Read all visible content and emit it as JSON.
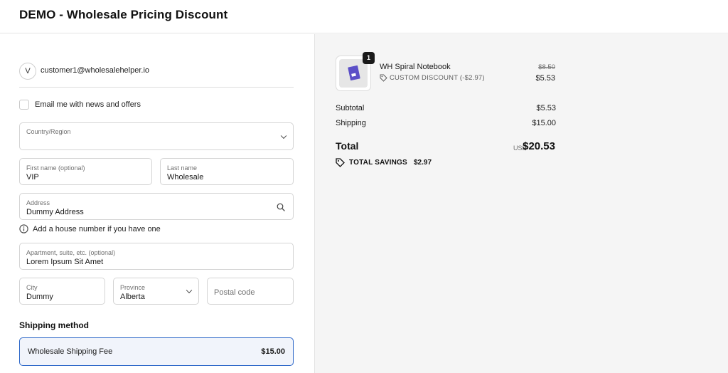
{
  "header": {
    "store_title": "DEMO - Wholesale Pricing Discount"
  },
  "account": {
    "avatar_initial": "V",
    "email": "customer1@wholesalehelper.io"
  },
  "marketing": {
    "checkbox_label": "Email me with news and offers",
    "checked": false
  },
  "form": {
    "country": {
      "label": "Country/Region",
      "value": ""
    },
    "first_name": {
      "label": "First name (optional)",
      "value": "VIP"
    },
    "last_name": {
      "label": "Last name",
      "value": "Wholesale"
    },
    "address": {
      "label": "Address",
      "value": "Dummy Address"
    },
    "address_hint": "Add a house number if you have one",
    "apartment": {
      "label": "Apartment, suite, etc. (optional)",
      "value": "Lorem Ipsum Sit Amet"
    },
    "city": {
      "label": "City",
      "value": "Dummy"
    },
    "province": {
      "label": "Province",
      "value": "Alberta"
    },
    "postal_code": {
      "placeholder": "Postal code",
      "value": ""
    }
  },
  "shipping": {
    "heading": "Shipping method",
    "option_name": "Wholesale Shipping Fee",
    "option_price": "$15.00"
  },
  "summary": {
    "item": {
      "quantity": "1",
      "name": "WH Spiral Notebook",
      "discount": "CUSTOM DISCOUNT (-$2.97)",
      "original_price": "$8.50",
      "price": "$5.53"
    },
    "subtotal_label": "Subtotal",
    "subtotal_value": "$5.53",
    "shipping_label": "Shipping",
    "shipping_value": "$15.00",
    "total_label": "Total",
    "currency": "USD",
    "total_value": "$20.53",
    "savings_label": "TOTAL SAVINGS",
    "savings_value": "$2.97"
  },
  "icons": [
    "chevron-down-icon",
    "search-icon",
    "info-icon",
    "tag-icon",
    "notebook-image"
  ]
}
